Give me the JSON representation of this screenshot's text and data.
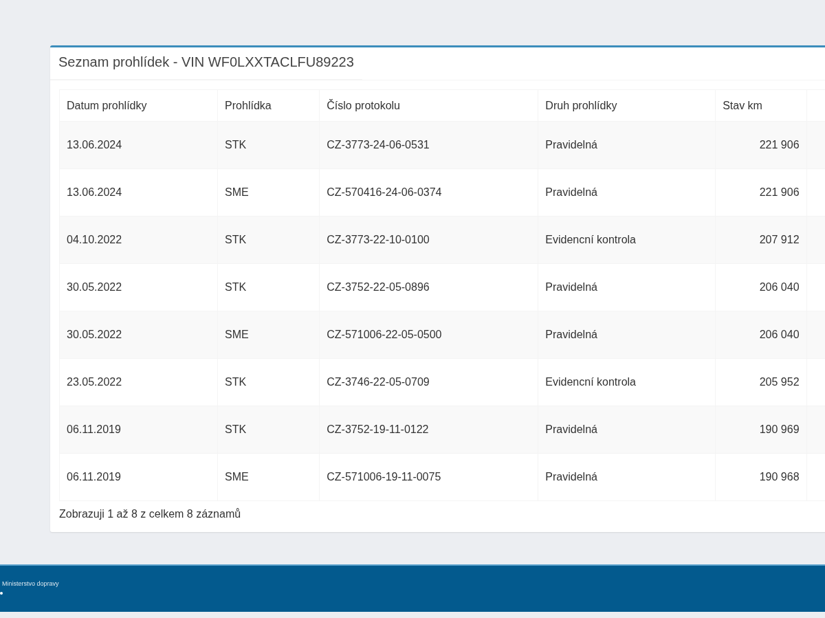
{
  "panel": {
    "title": "Seznam prohlídek - VIN WF0LXXTACLFU89223"
  },
  "table": {
    "columns": [
      "Datum prohlídky",
      "Prohlídka",
      "Číslo protokolu",
      "Druh prohlídky",
      "Stav km"
    ],
    "rows": [
      [
        "13.06.2024",
        "STK",
        "CZ-3773-24-06-0531",
        "Pravidelná",
        "221 906"
      ],
      [
        "13.06.2024",
        "SME",
        "CZ-570416-24-06-0374",
        "Pravidelná",
        "221 906"
      ],
      [
        "04.10.2022",
        "STK",
        "CZ-3773-22-10-0100",
        "Evidencní kontrola",
        "207 912"
      ],
      [
        "30.05.2022",
        "STK",
        "CZ-3752-22-05-0896",
        "Pravidelná",
        "206 040"
      ],
      [
        "30.05.2022",
        "SME",
        "CZ-571006-22-05-0500",
        "Pravidelná",
        "206 040"
      ],
      [
        "23.05.2022",
        "STK",
        "CZ-3746-22-05-0709",
        "Evidencní kontrola",
        "205 952"
      ],
      [
        "06.11.2019",
        "STK",
        "CZ-3752-19-11-0122",
        "Pravidelná",
        "190 969"
      ],
      [
        "06.11.2019",
        "SME",
        "CZ-571006-19-11-0075",
        "Pravidelná",
        "190 968"
      ]
    ]
  },
  "table_info": "Zobrazuji 1 až 8 z celkem 8 záznamů",
  "footer": {
    "text": "Ministerstvo dopravy"
  }
}
